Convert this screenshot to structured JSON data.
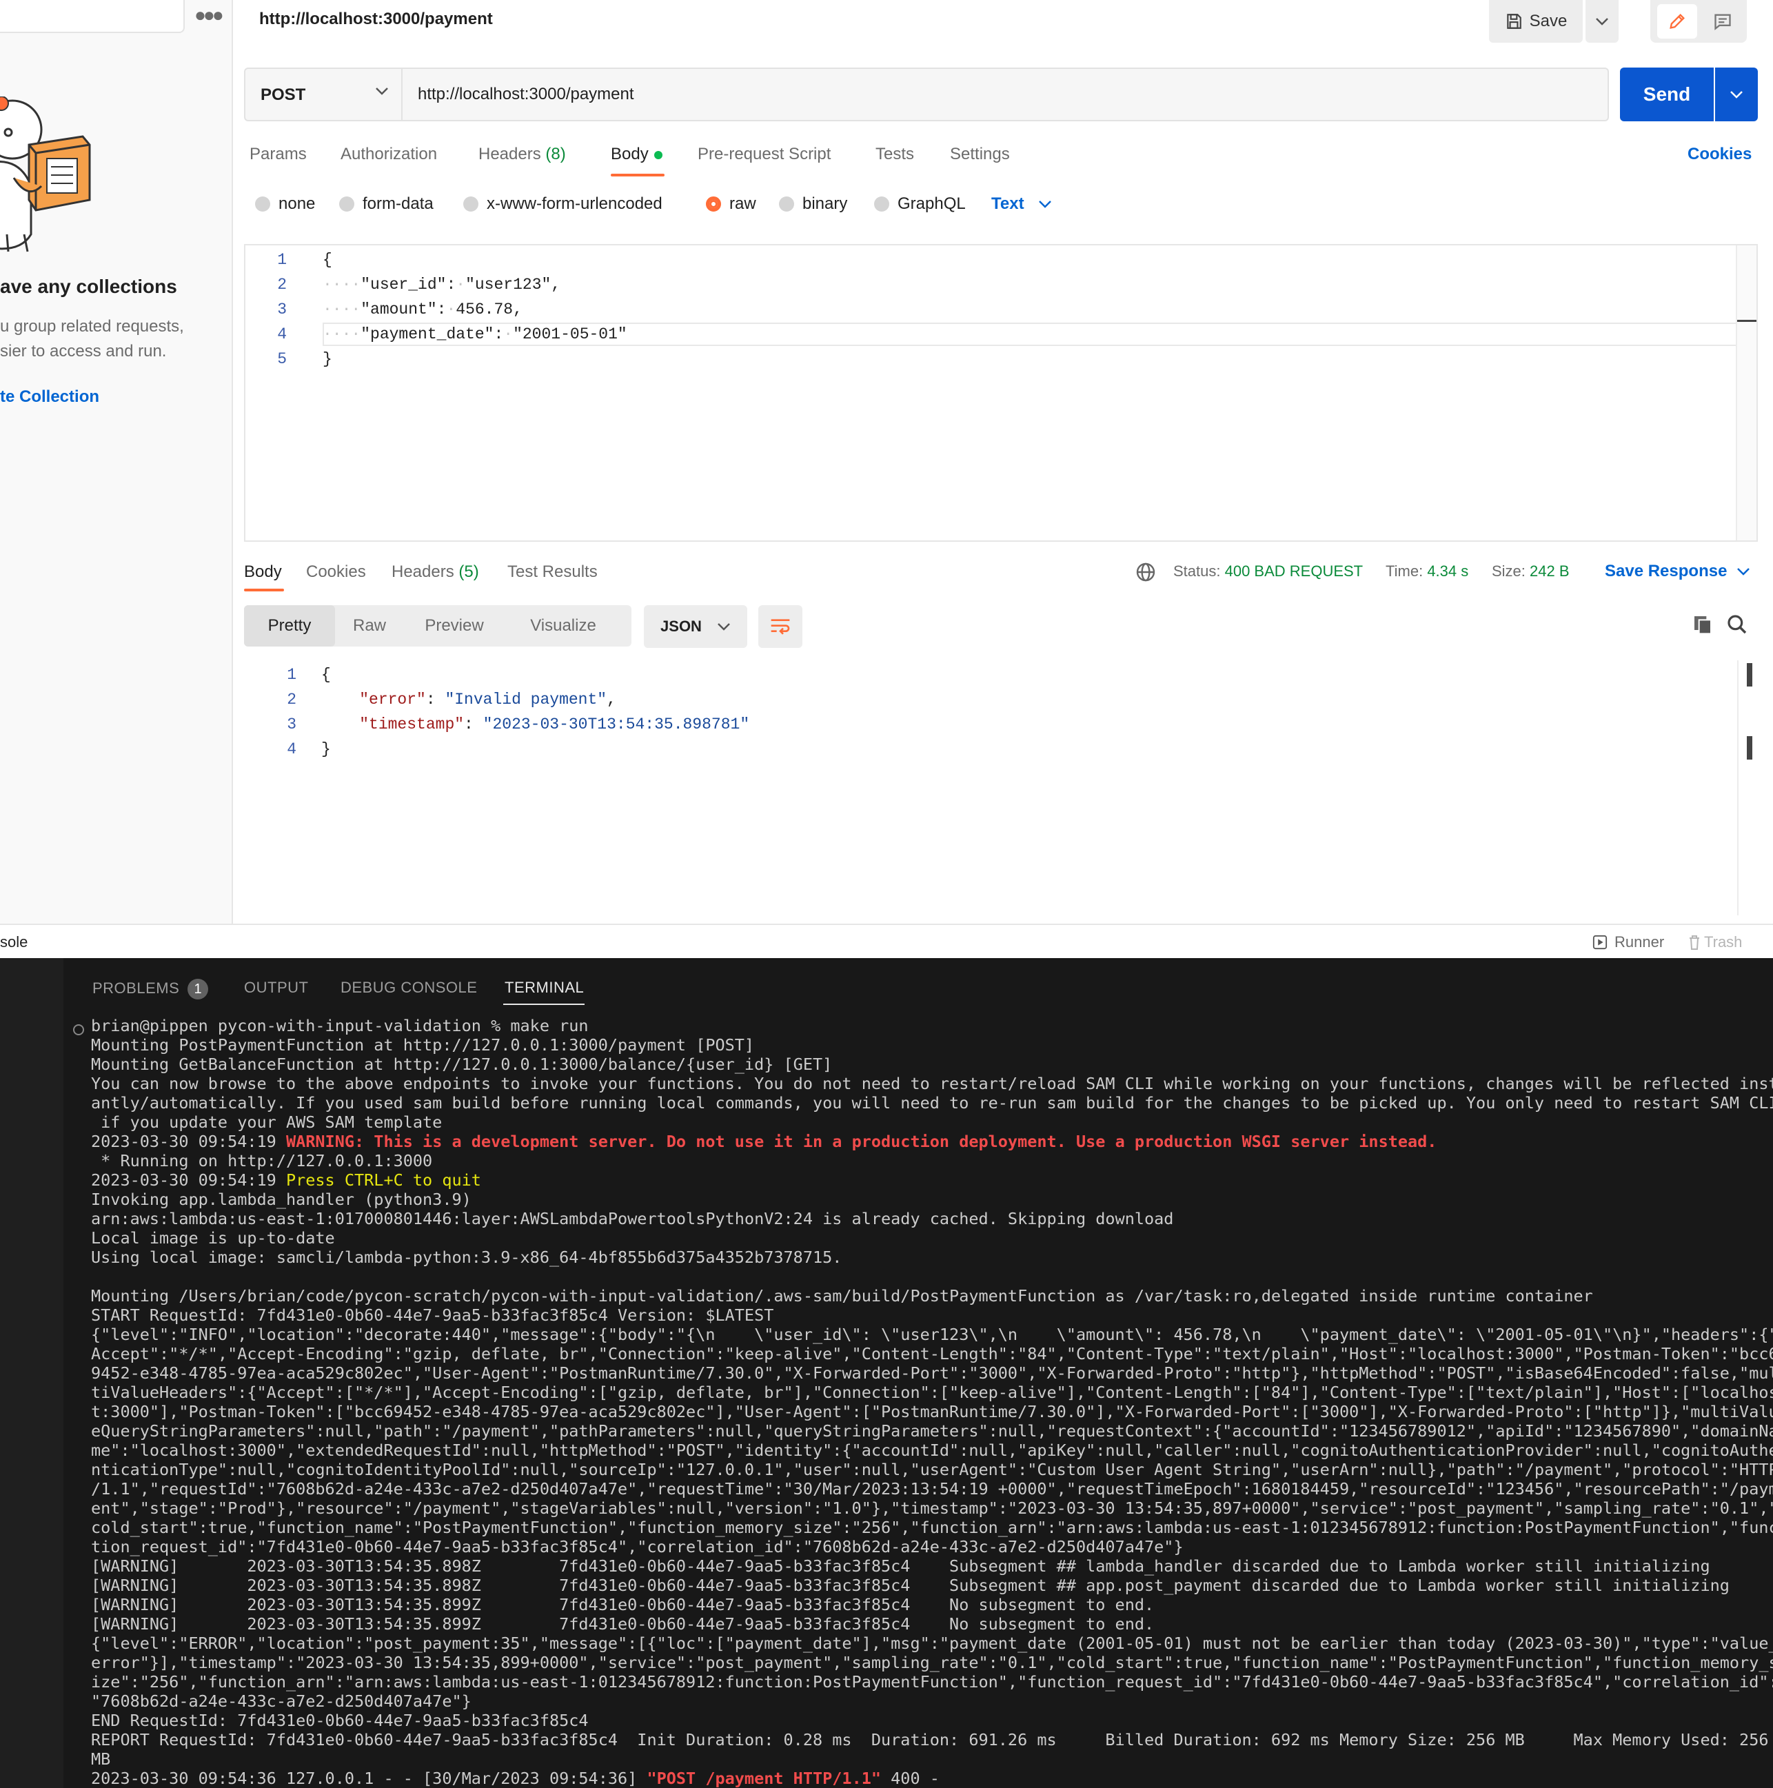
{
  "sidebar": {
    "empty_title": "ave any collections",
    "empty_desc": "u group related requests,\nsier to access and run.",
    "create_link": "te Collection"
  },
  "tab": {
    "url": "http://localhost:3000/payment",
    "save_label": "Save"
  },
  "request": {
    "method": "POST",
    "url": "http://localhost:3000/payment",
    "send_label": "Send",
    "tabs": {
      "params": "Params",
      "authorization": "Authorization",
      "headers": "Headers",
      "headers_count": "(8)",
      "body": "Body",
      "prerequest": "Pre-request Script",
      "tests": "Tests",
      "settings": "Settings"
    },
    "cookies_label": "Cookies",
    "body_types": [
      "none",
      "form-data",
      "x-www-form-urlencoded",
      "raw",
      "binary",
      "GraphQL"
    ],
    "selected_body_type": "raw",
    "text_format": "Text",
    "body_lines": {
      "l1": "{",
      "l2_key": "\"user_id\"",
      "l2_val": "\"user123\"",
      "l3_key": "\"amount\"",
      "l3_val": "456.78",
      "l4_key": "\"payment_date\"",
      "l4_val": "\"2001-05-01\"",
      "l5": "}"
    }
  },
  "response": {
    "tabs": {
      "body": "Body",
      "cookies": "Cookies",
      "headers": "Headers",
      "headers_count": "(5)",
      "tests": "Test Results"
    },
    "status_label": "Status:",
    "status": "400 BAD REQUEST",
    "time_label": "Time:",
    "time": "4.34 s",
    "size_label": "Size:",
    "size": "242 B",
    "save_response": "Save Response",
    "views": [
      "Pretty",
      "Raw",
      "Preview",
      "Visualize"
    ],
    "format": "JSON",
    "body_lines": {
      "l1": "{",
      "l2_key": "\"error\"",
      "l2_val": "\"Invalid payment\"",
      "l3_key": "\"timestamp\"",
      "l3_val": "\"2023-03-30T13:54:35.898781\"",
      "l4": "}"
    }
  },
  "console_bar": {
    "console": "sole",
    "runner": "Runner",
    "trash": "Trash"
  },
  "terminal": {
    "tabs": {
      "problems": "PROBLEMS",
      "problems_count": "1",
      "output": "OUTPUT",
      "debug": "DEBUG CONSOLE",
      "terminal": "TERMINAL"
    },
    "lines": [
      "brian@pippen pycon-with-input-validation % make run",
      "Mounting PostPaymentFunction at http://127.0.0.1:3000/payment [POST]",
      "Mounting GetBalanceFunction at http://127.0.0.1:3000/balance/{user_id} [GET]",
      "You can now browse to the above endpoints to invoke your functions. You do not need to restart/reload SAM CLI while working on your functions, changes will be reflected inst",
      "antly/automatically. If you used sam build before running local commands, you will need to re-run sam build for the changes to be picked up. You only need to restart SAM CLI",
      " if you update your AWS SAM template",
      "2023-03-30 09:54:19 ",
      " * Running on http://127.0.0.1:3000",
      "2023-03-30 09:54:19 ",
      "Invoking app.lambda_handler (python3.9)",
      "arn:aws:lambda:us-east-1:017000801446:layer:AWSLambdaPowertoolsPythonV2:24 is already cached. Skipping download",
      "Local image is up-to-date",
      "Using local image: samcli/lambda-python:3.9-x86_64-4bf855b6d375a4352b7378715.",
      "",
      "Mounting /Users/brian/code/pycon-scratch/pycon-with-input-validation/.aws-sam/build/PostPaymentFunction as /var/task:ro,delegated inside runtime container",
      "START RequestId: 7fd431e0-0b60-44e7-9aa5-b33fac3f85c4 Version: $LATEST",
      "{\"level\":\"INFO\",\"location\":\"decorate:440\",\"message\":{\"body\":\"{\\n    \\\"user_id\\\": \\\"user123\\\",\\n    \\\"amount\\\": 456.78,\\n    \\\"payment_date\\\": \\\"2001-05-01\\\"\\n}\",\"headers\":{\"",
      "Accept\":\"*/*\",\"Accept-Encoding\":\"gzip, deflate, br\",\"Connection\":\"keep-alive\",\"Content-Length\":\"84\",\"Content-Type\":\"text/plain\",\"Host\":\"localhost:3000\",\"Postman-Token\":\"bcc6",
      "9452-e348-4785-97ea-aca529c802ec\",\"User-Agent\":\"PostmanRuntime/7.30.0\",\"X-Forwarded-Port\":\"3000\",\"X-Forwarded-Proto\":\"http\"},\"httpMethod\":\"POST\",\"isBase64Encoded\":false,\"mul",
      "tiValueHeaders\":{\"Accept\":[\"*/*\"],\"Accept-Encoding\":[\"gzip, deflate, br\"],\"Connection\":[\"keep-alive\"],\"Content-Length\":[\"84\"],\"Content-Type\":[\"text/plain\"],\"Host\":[\"localhos",
      "t:3000\"],\"Postman-Token\":[\"bcc69452-e348-4785-97ea-aca529c802ec\"],\"User-Agent\":[\"PostmanRuntime/7.30.0\"],\"X-Forwarded-Port\":[\"3000\"],\"X-Forwarded-Proto\":[\"http\"]},\"multiValu",
      "eQueryStringParameters\":null,\"path\":\"/payment\",\"pathParameters\":null,\"queryStringParameters\":null,\"requestContext\":{\"accountId\":\"123456789012\",\"apiId\":\"1234567890\",\"domainNa",
      "me\":\"localhost:3000\",\"extendedRequestId\":null,\"httpMethod\":\"POST\",\"identity\":{\"accountId\":null,\"apiKey\":null,\"caller\":null,\"cognitoAuthenticationProvider\":null,\"cognitoAuthe",
      "nticationType\":null,\"cognitoIdentityPoolId\":null,\"sourceIp\":\"127.0.0.1\",\"user\":null,\"userAgent\":\"Custom User Agent String\",\"userArn\":null},\"path\":\"/payment\",\"protocol\":\"HTTP",
      "/1.1\",\"requestId\":\"7608b62d-a24e-433c-a7e2-d250d407a47e\",\"requestTime\":\"30/Mar/2023:13:54:19 +0000\",\"requestTimeEpoch\":1680184459,\"resourceId\":\"123456\",\"resourcePath\":\"/paym",
      "ent\",\"stage\":\"Prod\"},\"resource\":\"/payment\",\"stageVariables\":null,\"version\":\"1.0\"},\"timestamp\":\"2023-03-30 13:54:35,897+0000\",\"service\":\"post_payment\",\"sampling_rate\":\"0.1\",\"",
      "cold_start\":true,\"function_name\":\"PostPaymentFunction\",\"function_memory_size\":\"256\",\"function_arn\":\"arn:aws:lambda:us-east-1:012345678912:function:PostPaymentFunction\",\"func",
      "tion_request_id\":\"7fd431e0-0b60-44e7-9aa5-b33fac3f85c4\",\"correlation_id\":\"7608b62d-a24e-433c-a7e2-d250d407a47e\"}",
      "[WARNING]       2023-03-30T13:54:35.898Z        7fd431e0-0b60-44e7-9aa5-b33fac3f85c4    Subsegment ## lambda_handler discarded due to Lambda worker still initializing",
      "[WARNING]       2023-03-30T13:54:35.898Z        7fd431e0-0b60-44e7-9aa5-b33fac3f85c4    Subsegment ## app.post_payment discarded due to Lambda worker still initializing",
      "[WARNING]       2023-03-30T13:54:35.899Z        7fd431e0-0b60-44e7-9aa5-b33fac3f85c4    No subsegment to end.",
      "[WARNING]       2023-03-30T13:54:35.899Z        7fd431e0-0b60-44e7-9aa5-b33fac3f85c4    No subsegment to end.",
      "{\"level\":\"ERROR\",\"location\":\"post_payment:35\",\"message\":[{\"loc\":[\"payment_date\"],\"msg\":\"payment_date (2001-05-01) must not be earlier than today (2023-03-30)\",\"type\":\"value_",
      "error\"}],\"timestamp\":\"2023-03-30 13:54:35,899+0000\",\"service\":\"post_payment\",\"sampling_rate\":\"0.1\",\"cold_start\":true,\"function_name\":\"PostPaymentFunction\",\"function_memory_s",
      "ize\":\"256\",\"function_arn\":\"arn:aws:lambda:us-east-1:012345678912:function:PostPaymentFunction\",\"function_request_id\":\"7fd431e0-0b60-44e7-9aa5-b33fac3f85c4\",\"correlation_id\":",
      "\"7608b62d-a24e-433c-a7e2-d250d407a47e\"}",
      "END RequestId: 7fd431e0-0b60-44e7-9aa5-b33fac3f85c4",
      "REPORT RequestId: 7fd431e0-0b60-44e7-9aa5-b33fac3f85c4  Init Duration: 0.28 ms  Duration: 691.26 ms     Billed Duration: 692 ms Memory Size: 256 MB     Max Memory Used: 256",
      "MB",
      "2023-03-30 09:54:36 127.0.0.1 - - [30/Mar/2023 09:54:36] "
    ],
    "warning_text": "WARNING: This is a development server. Do not use it in a production deployment. Use a production WSGI server instead.",
    "quit_text": "Press CTRL+C to quit",
    "post_text": "\"POST /payment HTTP/1.1\"",
    "post_tail": " 400 -"
  },
  "colors": {
    "accent": "#ff6c37",
    "send": "#0b57d0",
    "link": "#0265d2",
    "status_green": "#0b8a3a",
    "terminal_bg": "#181818",
    "warning_red": "#f14c4c",
    "press_yellow": "#e5e510"
  }
}
